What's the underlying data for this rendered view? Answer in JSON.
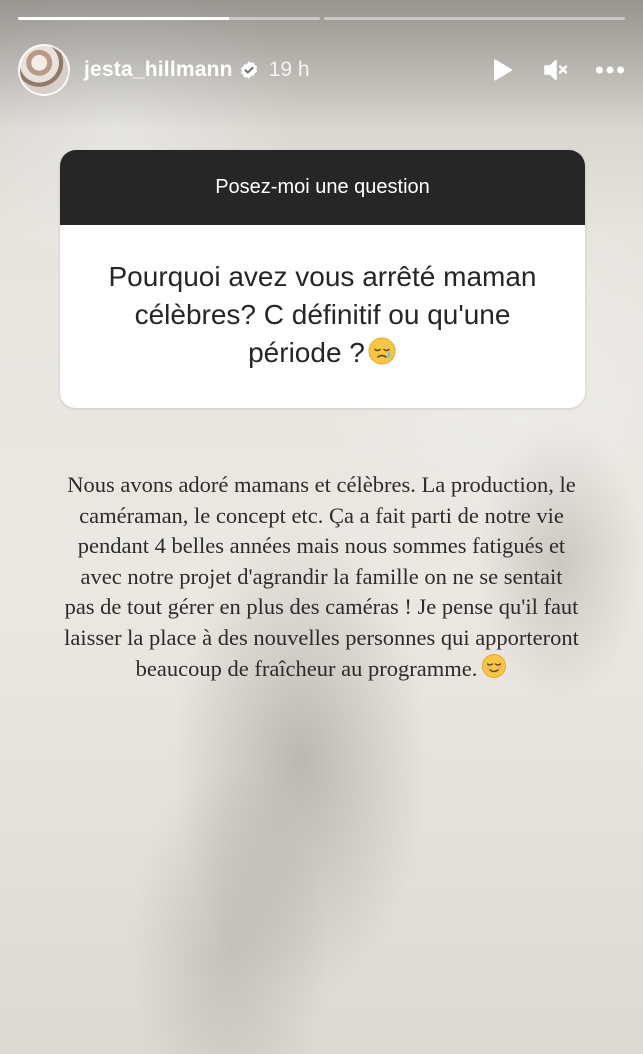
{
  "story": {
    "progress": {
      "segments": [
        {
          "filled": 0.7
        },
        {
          "filled": 0
        }
      ]
    },
    "header": {
      "username": "jesta_hillmann",
      "verified": true,
      "time": "19 h",
      "icons": [
        "play-icon",
        "mute-icon",
        "more-icon"
      ]
    },
    "question_sticker": {
      "title": "Posez-moi une question",
      "question_lines": [
        "Pourquoi avez vous arrêté maman",
        "célèbres? C définitif ou qu'une",
        "période ?"
      ],
      "emoji": "face-holding-back-tears"
    },
    "answer": {
      "lines": [
        "Nous avons adoré mamans et célèbres. La production, le",
        "caméraman, le concept etc. Ça a fait parti de notre vie",
        "pendant 4 belles années mais nous sommes fatigués et",
        "avec notre projet d'agrandir la famille on ne se sentait",
        "pas de tout gérer en plus des caméras ! Je pense qu'il faut",
        "laisser la place à des nouvelles personnes qui apporteront",
        "beaucoup de fraîcheur au programme."
      ],
      "emoji": "relieved-face"
    },
    "colors": {
      "sticker_header": "#262626",
      "sticker_body": "#ffffff",
      "text": "#2b2b2b",
      "header_text": "#ffffff"
    }
  }
}
